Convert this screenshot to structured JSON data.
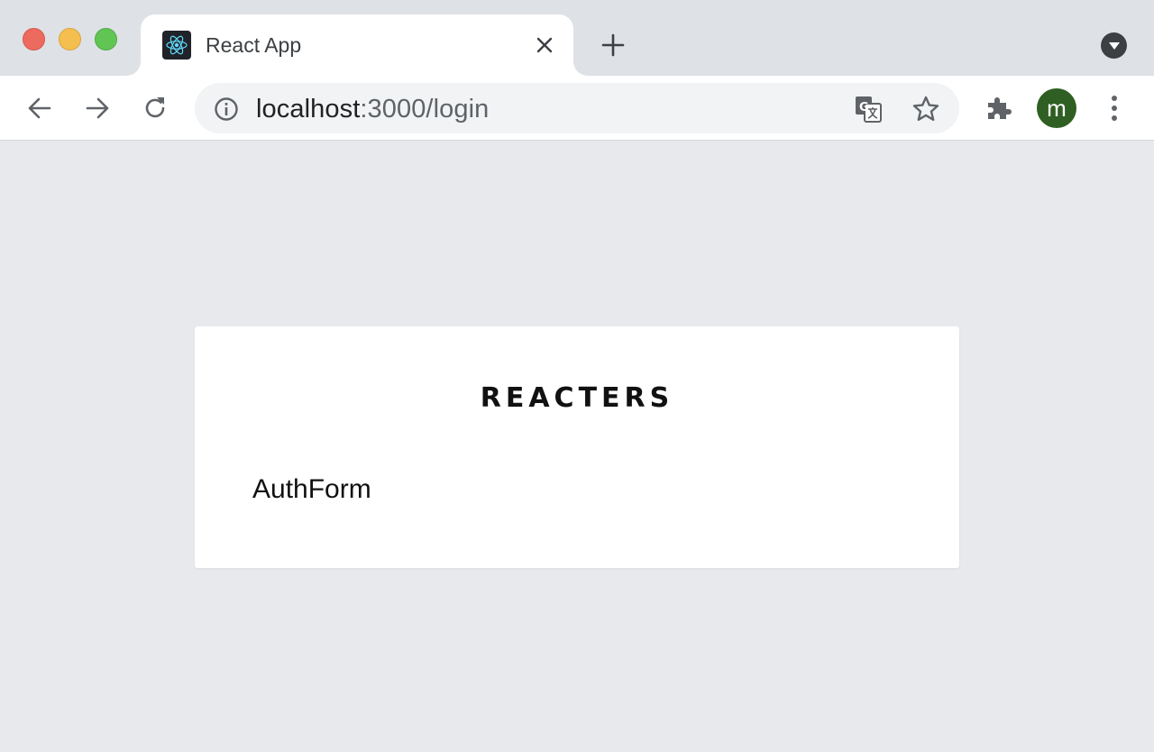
{
  "browser": {
    "tab": {
      "title": "React App",
      "favicon": "react-logo-icon"
    },
    "address_bar": {
      "host": "localhost",
      "path": ":3000/login"
    },
    "profile_initial": "m",
    "colors": {
      "tabstrip": "#dee1e6",
      "omnibox": "#f1f3f4",
      "avatar": "#2f5f22",
      "page_background": "#e8e9ed"
    }
  },
  "page": {
    "brand": "REACTERS",
    "form_placeholder_text": "AuthForm"
  }
}
